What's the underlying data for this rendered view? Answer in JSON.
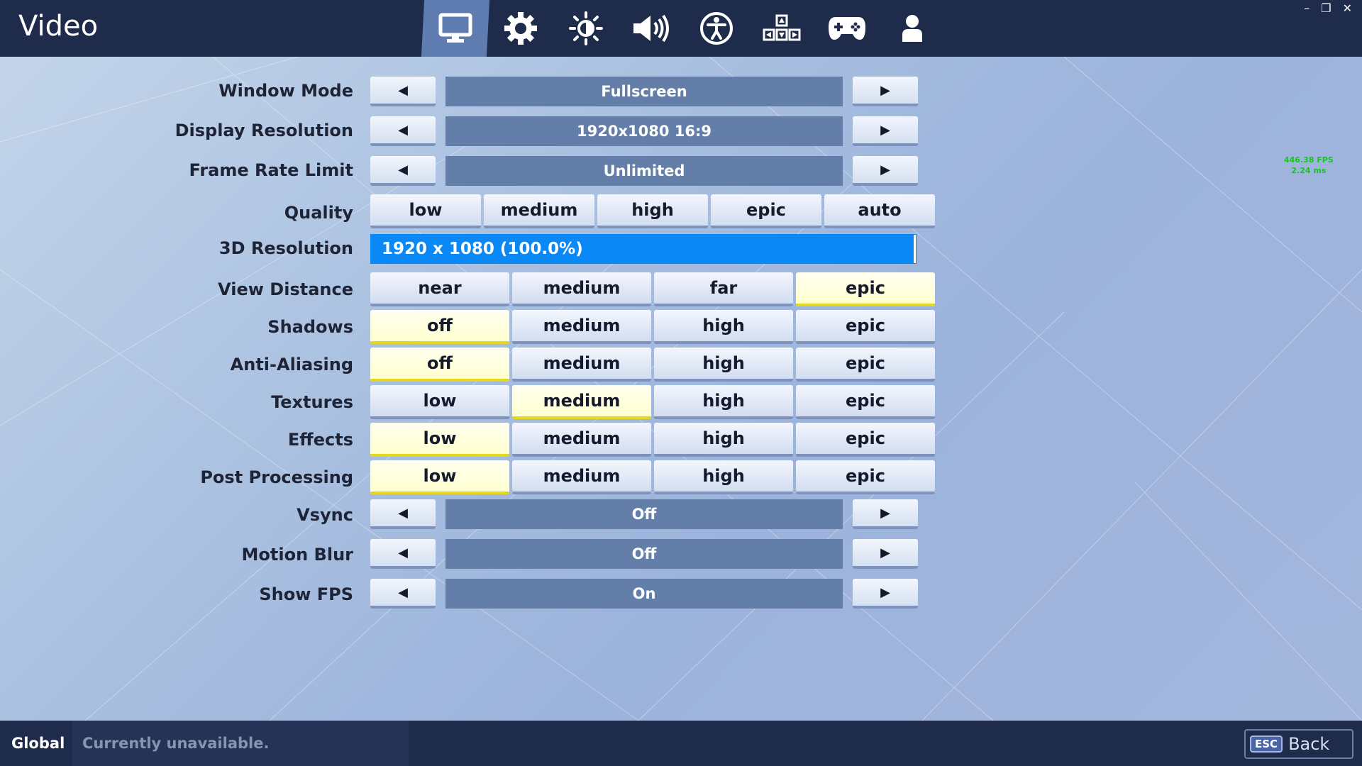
{
  "header": {
    "title": "Video",
    "tabs": [
      {
        "icon": "monitor-icon",
        "active": true
      },
      {
        "icon": "gear-icon",
        "active": false
      },
      {
        "icon": "brightness-icon",
        "active": false
      },
      {
        "icon": "speaker-icon",
        "active": false
      },
      {
        "icon": "accessibility-icon",
        "active": false
      },
      {
        "icon": "input-keys-icon",
        "active": false
      },
      {
        "icon": "gamepad-icon",
        "active": false
      },
      {
        "icon": "account-icon",
        "active": false
      }
    ],
    "window_controls": {
      "minimize": "–",
      "restore": "❐",
      "close": "✕"
    }
  },
  "fps_counter": {
    "fps": "446.38 FPS",
    "ms": "2.24 ms"
  },
  "settings": {
    "window_mode": {
      "label": "Window Mode",
      "value": "Fullscreen"
    },
    "display_resolution": {
      "label": "Display Resolution",
      "value": "1920x1080 16:9"
    },
    "frame_rate_limit": {
      "label": "Frame Rate Limit",
      "value": "Unlimited"
    },
    "quality": {
      "label": "Quality",
      "options": [
        "low",
        "medium",
        "high",
        "epic",
        "auto"
      ],
      "selected": -1
    },
    "resolution_3d": {
      "label": "3D Resolution",
      "value": "1920 x 1080 (100.0%)",
      "percent": 100
    },
    "view_distance": {
      "label": "View Distance",
      "options": [
        "near",
        "medium",
        "far",
        "epic"
      ],
      "selected": 3
    },
    "shadows": {
      "label": "Shadows",
      "options": [
        "off",
        "medium",
        "high",
        "epic"
      ],
      "selected": 0
    },
    "anti_aliasing": {
      "label": "Anti-Aliasing",
      "options": [
        "off",
        "medium",
        "high",
        "epic"
      ],
      "selected": 0
    },
    "textures": {
      "label": "Textures",
      "options": [
        "low",
        "medium",
        "high",
        "epic"
      ],
      "selected": 1
    },
    "effects": {
      "label": "Effects",
      "options": [
        "low",
        "medium",
        "high",
        "epic"
      ],
      "selected": 0
    },
    "post_processing": {
      "label": "Post Processing",
      "options": [
        "low",
        "medium",
        "high",
        "epic"
      ],
      "selected": 0
    },
    "vsync": {
      "label": "Vsync",
      "value": "Off"
    },
    "motion_blur": {
      "label": "Motion Blur",
      "value": "Off"
    },
    "show_fps": {
      "label": "Show FPS",
      "value": "On"
    }
  },
  "arrows": {
    "left": "◀",
    "right": "▶"
  },
  "footer": {
    "scope": "Global",
    "status": "Currently unavailable.",
    "esc_key": "ESC",
    "back_label": "Back"
  },
  "colors": {
    "topbar": "#1e2b4a",
    "active_tab": "#5f7cb0",
    "value_box": "#627ea9",
    "selected_option": "#ffffcf",
    "resolution_bar": "#0a88f5",
    "fps_text": "#12c81c"
  }
}
